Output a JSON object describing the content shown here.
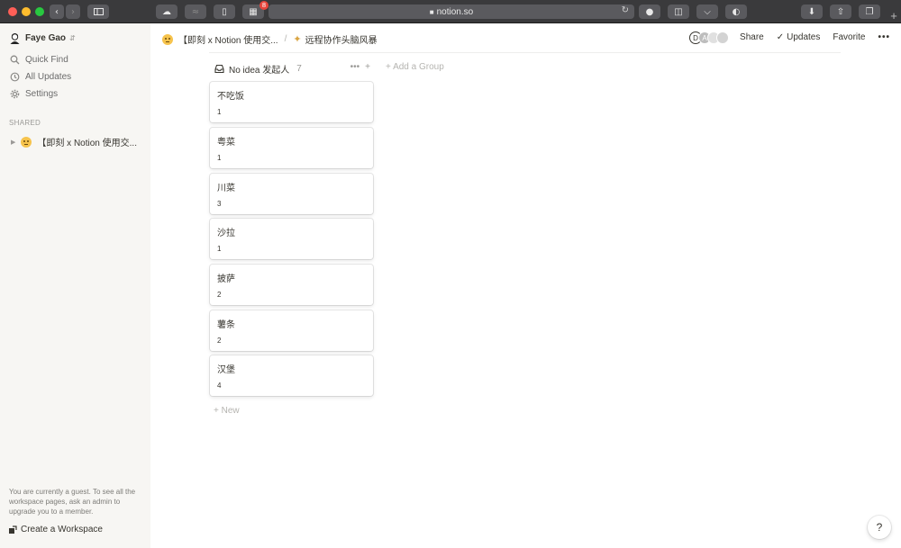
{
  "browser": {
    "url": "notion.so",
    "notification_count": "8"
  },
  "sidebar": {
    "workspace_name": "Faye Gao",
    "nav": [
      {
        "label": "Quick Find",
        "icon": "search-icon"
      },
      {
        "label": "All Updates",
        "icon": "clock-icon"
      },
      {
        "label": "Settings",
        "icon": "gear-icon"
      }
    ],
    "shared_label": "SHARED",
    "shared_pages": [
      {
        "label": "【即刻 x Notion 使用交..."
      }
    ],
    "guest_note": "You are currently a guest. To see all the workspace pages, ask an admin to upgrade you to a member.",
    "create_workspace": "Create a Workspace"
  },
  "topbar": {
    "breadcrumb_parent": "【即刻 x Notion 使用交...",
    "breadcrumb_separator": "/",
    "breadcrumb_current": "远程协作头脑风暴",
    "avatars": [
      "D",
      "A"
    ],
    "share": "Share",
    "updates": "Updates",
    "favorite": "Favorite",
    "more": "•••"
  },
  "board": {
    "group_name": "No idea 发起人",
    "group_count": "7",
    "group_more": "•••",
    "group_add": "+",
    "add_group": "+ Add a Group",
    "new_card": "+ New",
    "cards": [
      {
        "title": "不吃饭",
        "value": "1"
      },
      {
        "title": "粤菜",
        "value": "1"
      },
      {
        "title": "川菜",
        "value": "3"
      },
      {
        "title": "沙拉",
        "value": "1"
      },
      {
        "title": "披萨",
        "value": "2"
      },
      {
        "title": "薯条",
        "value": "2"
      },
      {
        "title": "汉堡",
        "value": "4"
      }
    ]
  },
  "help": "?"
}
